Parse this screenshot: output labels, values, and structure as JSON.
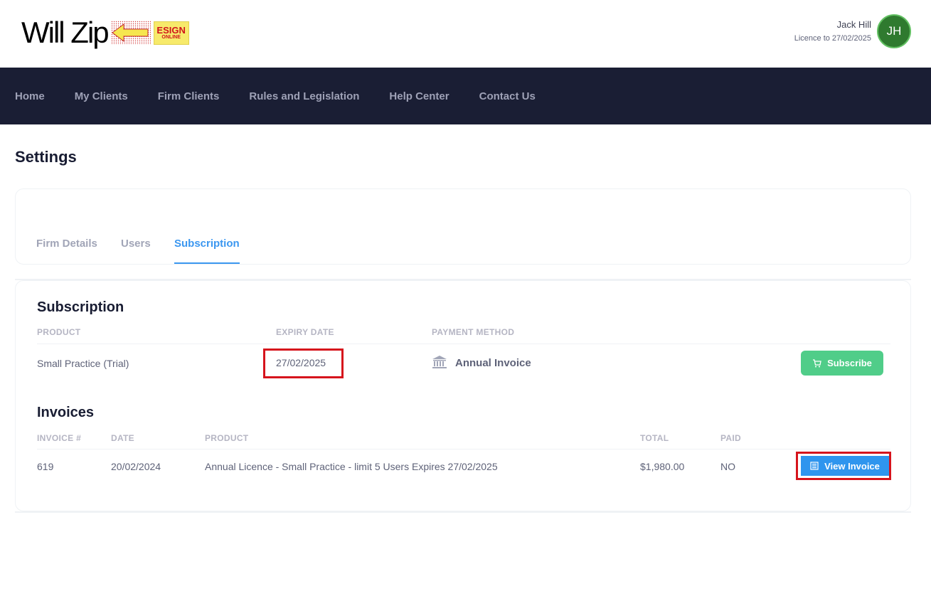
{
  "brand": {
    "logo_text": "Will Zip",
    "badge_line1": "ESIGN",
    "badge_line2": "ONLINE",
    "accent": "#3b97f0"
  },
  "user": {
    "name": "Jack Hill",
    "licence": "Licence to 27/02/2025",
    "initials": "JH",
    "avatar_color": "#2f7a2f"
  },
  "nav": {
    "items": [
      "Home",
      "My Clients",
      "Firm Clients",
      "Rules and Legislation",
      "Help Center",
      "Contact Us"
    ]
  },
  "page": {
    "title": "Settings"
  },
  "tabs": {
    "items": [
      "Firm Details",
      "Users",
      "Subscription"
    ],
    "active": "Subscription"
  },
  "subscription": {
    "title": "Subscription",
    "headers": {
      "product": "PRODUCT",
      "expiry": "EXPIRY DATE",
      "payment": "PAYMENT METHOD"
    },
    "row": {
      "product": "Small Practice (Trial)",
      "expiry": "27/02/2025",
      "payment_method": "Annual Invoice",
      "payment_icon": "bank-icon"
    },
    "subscribe_label": "Subscribe",
    "subscribe_icon": "cart-icon",
    "subscribe_color": "#50cd89"
  },
  "invoices": {
    "title": "Invoices",
    "headers": {
      "number": "INVOICE #",
      "date": "DATE",
      "product": "PRODUCT",
      "total": "TOTAL",
      "paid": "PAID"
    },
    "rows": [
      {
        "number": "619",
        "date": "20/02/2024",
        "product": "Annual Licence - Small Practice - limit 5 Users Expires 27/02/2025",
        "total": "$1,980.00",
        "paid": "NO",
        "action_label": "View Invoice"
      }
    ],
    "action_icon": "document-icon",
    "action_color": "#2f95ee"
  },
  "highlight_color": "#d6141c"
}
